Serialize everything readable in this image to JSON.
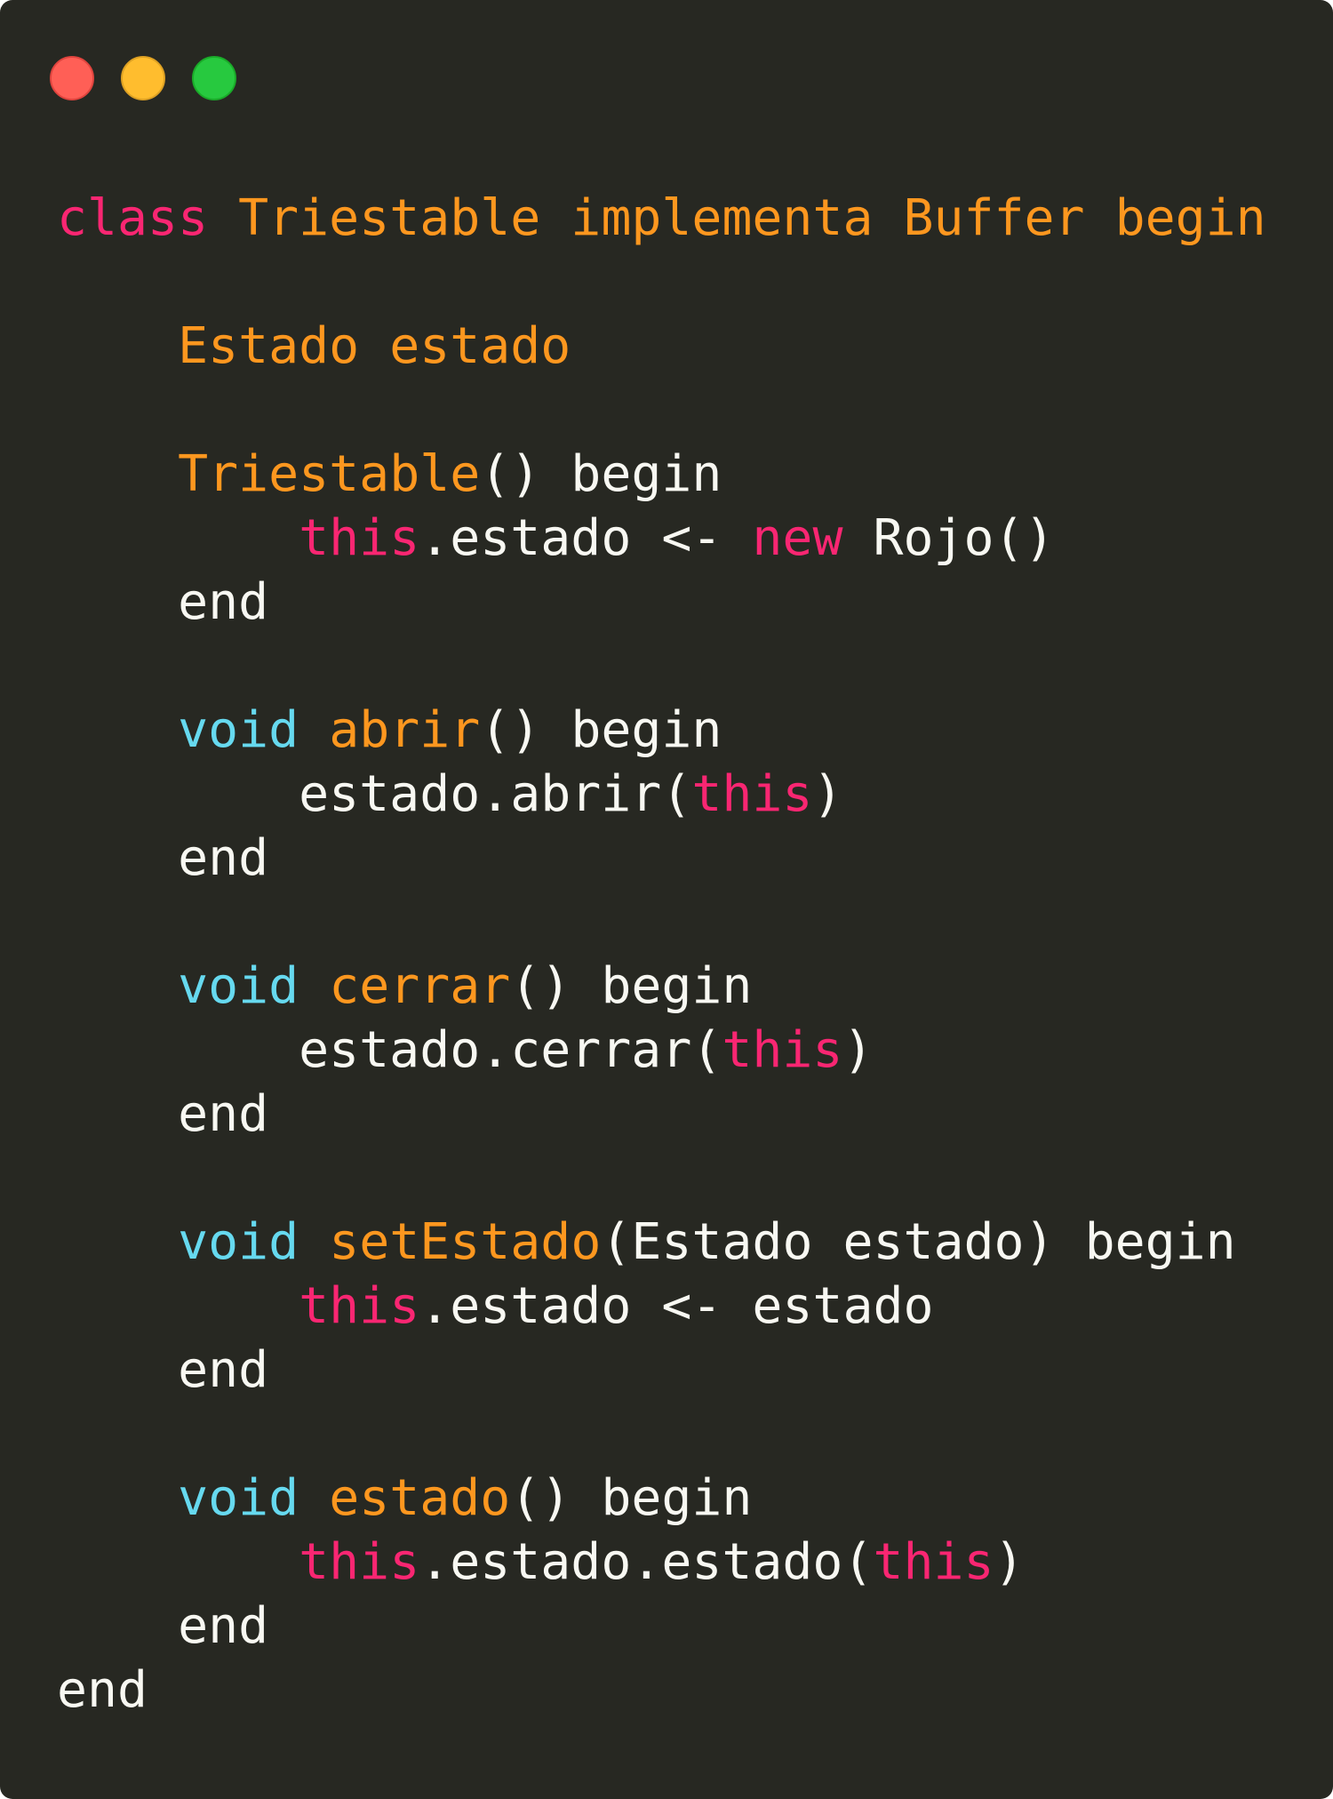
{
  "window": {
    "controls": [
      "close",
      "minimize",
      "maximize"
    ]
  },
  "colors": {
    "background": "#272822",
    "keyword": "#f92672",
    "name": "#fd971f",
    "type": "#66d9ef",
    "plain": "#f8f8f2"
  },
  "code": {
    "lines": [
      [
        [
          "keyword",
          "class"
        ],
        [
          "plain",
          " "
        ],
        [
          "name",
          "Triestable implementa Buffer begin"
        ]
      ],
      [],
      [
        [
          "plain",
          "    "
        ],
        [
          "name",
          "Estado estado"
        ]
      ],
      [],
      [
        [
          "plain",
          "    "
        ],
        [
          "name",
          "Triestable"
        ],
        [
          "plain",
          "() begin"
        ]
      ],
      [
        [
          "plain",
          "        "
        ],
        [
          "keyword",
          "this"
        ],
        [
          "plain",
          ".estado <- "
        ],
        [
          "keyword",
          "new"
        ],
        [
          "plain",
          " Rojo()"
        ]
      ],
      [
        [
          "plain",
          "    end"
        ]
      ],
      [],
      [
        [
          "plain",
          "    "
        ],
        [
          "type",
          "void"
        ],
        [
          "plain",
          " "
        ],
        [
          "name",
          "abrir"
        ],
        [
          "plain",
          "() begin"
        ]
      ],
      [
        [
          "plain",
          "        estado.abrir("
        ],
        [
          "keyword",
          "this"
        ],
        [
          "plain",
          ")"
        ]
      ],
      [
        [
          "plain",
          "    end"
        ]
      ],
      [],
      [
        [
          "plain",
          "    "
        ],
        [
          "type",
          "void"
        ],
        [
          "plain",
          " "
        ],
        [
          "name",
          "cerrar"
        ],
        [
          "plain",
          "() begin"
        ]
      ],
      [
        [
          "plain",
          "        estado.cerrar("
        ],
        [
          "keyword",
          "this"
        ],
        [
          "plain",
          ")"
        ]
      ],
      [
        [
          "plain",
          "    end"
        ]
      ],
      [],
      [
        [
          "plain",
          "    "
        ],
        [
          "type",
          "void"
        ],
        [
          "plain",
          " "
        ],
        [
          "name",
          "setEstado"
        ],
        [
          "plain",
          "(Estado estado) begin"
        ]
      ],
      [
        [
          "plain",
          "        "
        ],
        [
          "keyword",
          "this"
        ],
        [
          "plain",
          ".estado <- estado"
        ]
      ],
      [
        [
          "plain",
          "    end"
        ]
      ],
      [],
      [
        [
          "plain",
          "    "
        ],
        [
          "type",
          "void"
        ],
        [
          "plain",
          " "
        ],
        [
          "name",
          "estado"
        ],
        [
          "plain",
          "() begin"
        ]
      ],
      [
        [
          "plain",
          "        "
        ],
        [
          "keyword",
          "this"
        ],
        [
          "plain",
          ".estado.estado("
        ],
        [
          "keyword",
          "this"
        ],
        [
          "plain",
          ")"
        ]
      ],
      [
        [
          "plain",
          "    end"
        ]
      ],
      [
        [
          "plain",
          "end"
        ]
      ]
    ]
  }
}
